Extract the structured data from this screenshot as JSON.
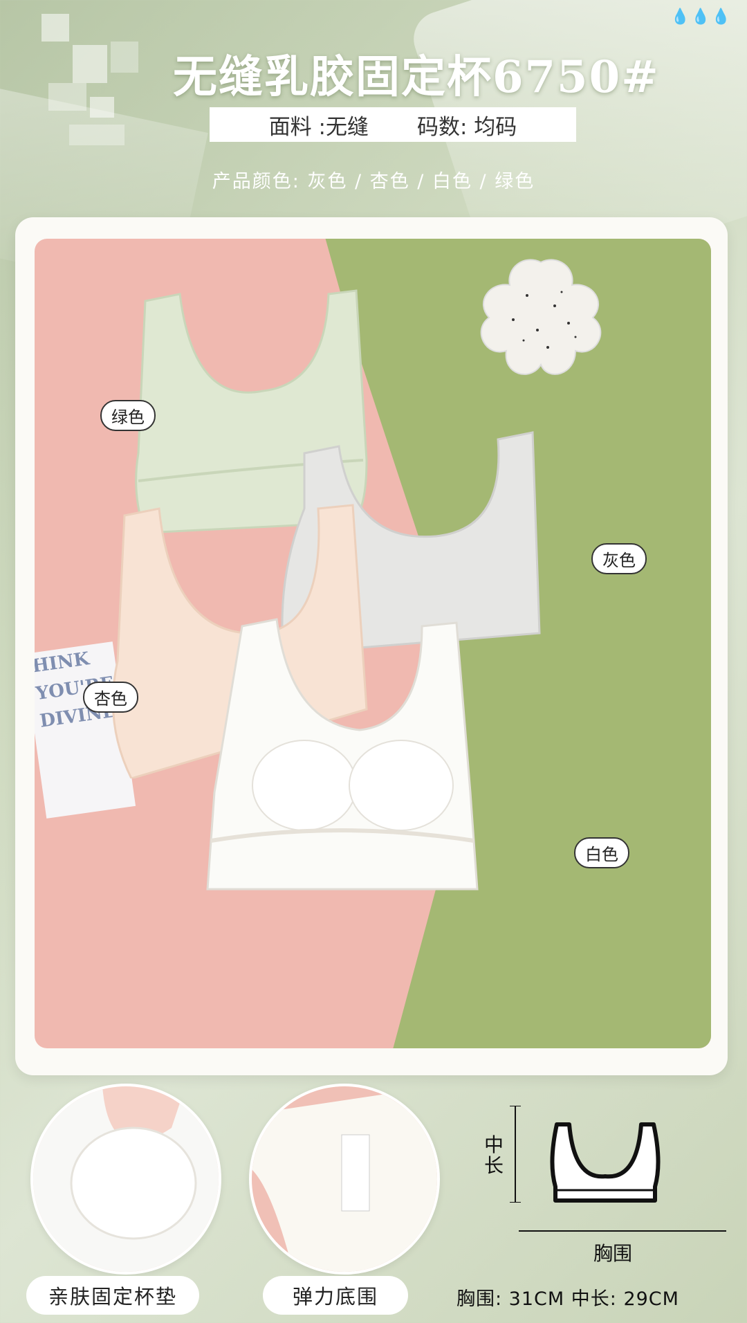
{
  "header": {
    "title": "无缝乳胶固定杯6750#",
    "fabric": "面料 :无缝",
    "size": "码数: 均码",
    "colors_line": "产品颜色: 灰色 / 杏色 / 白色 / 绿色"
  },
  "photo": {
    "tags": {
      "green": "绿色",
      "gray": "灰色",
      "apricot": "杏色",
      "white": "白色"
    },
    "card_text": [
      "HINK",
      "YOU'RE",
      "DIVINE"
    ]
  },
  "features": {
    "cup_pad": "亲肤固定杯垫",
    "elastic_band": "弹力底围"
  },
  "size_chart": {
    "length_label": "中长",
    "chest_label": "胸围",
    "measurements": "胸围: 31CM  中长: 29CM"
  },
  "colors": {
    "accent_green": "#a4b873",
    "accent_pink": "#f0b9b0"
  }
}
